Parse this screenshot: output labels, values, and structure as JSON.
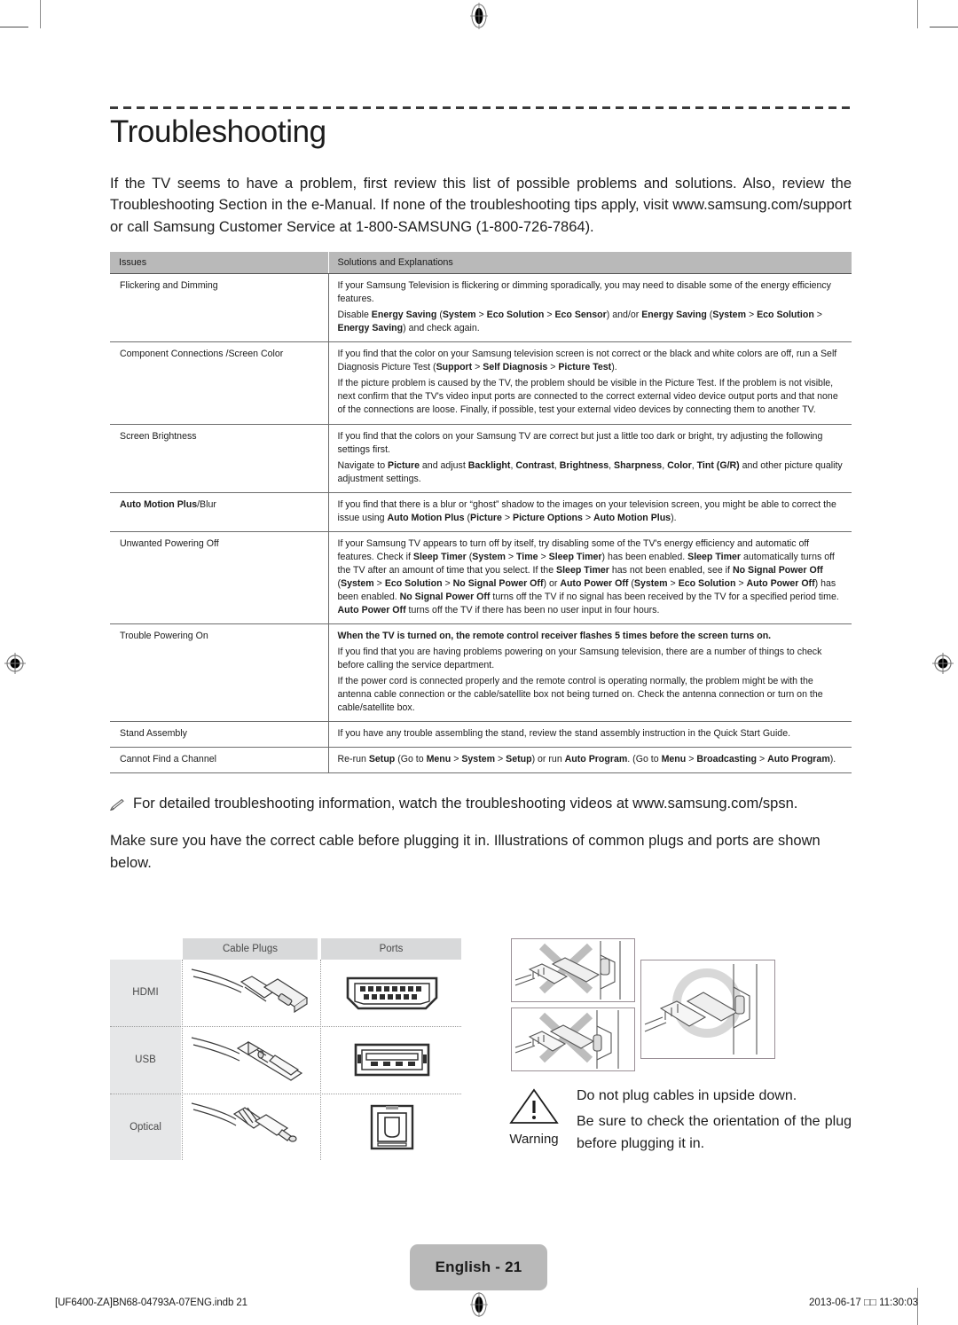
{
  "document": {
    "chapter_title": "Troubleshooting",
    "intro": "If the TV seems to have a problem, first review this list of possible problems and solutions. Also, review the Troubleshooting Section in the e-Manual. If none of the troubleshooting tips apply, visit www.samsung.com/support or call Samsung Customer Service at 1-800-SAMSUNG (1-800-726-7864)."
  },
  "troubleshooting_table": {
    "headers": [
      "Issues",
      "Solutions and Explanations"
    ],
    "rows": [
      {
        "issue": "Flickering and Dimming",
        "paragraphs": [
          [
            {
              "t": "If your Samsung Television is flickering or dimming sporadically, you may need to disable some of the energy efficiency features.",
              "b": false
            }
          ],
          [
            {
              "t": "Disable ",
              "b": false
            },
            {
              "t": "Energy Saving",
              "b": true
            },
            {
              "t": " (",
              "b": false
            },
            {
              "t": "System",
              "b": true
            },
            {
              "t": " > ",
              "b": false
            },
            {
              "t": "Eco Solution",
              "b": true
            },
            {
              "t": " > ",
              "b": false
            },
            {
              "t": "Eco Sensor",
              "b": true
            },
            {
              "t": ") and/or ",
              "b": false
            },
            {
              "t": "Energy Saving",
              "b": true
            },
            {
              "t": " (",
              "b": false
            },
            {
              "t": "System",
              "b": true
            },
            {
              "t": " > ",
              "b": false
            },
            {
              "t": "Eco Solution",
              "b": true
            },
            {
              "t": " > ",
              "b": false
            },
            {
              "t": "Energy Saving",
              "b": true
            },
            {
              "t": ") and check again.",
              "b": false
            }
          ]
        ]
      },
      {
        "issue": "Component Connections /Screen Color",
        "paragraphs": [
          [
            {
              "t": "If you find that the color on your Samsung television screen is not correct or the black and white colors are off, run a Self Diagnosis Picture Test (",
              "b": false
            },
            {
              "t": "Support",
              "b": true
            },
            {
              "t": " > ",
              "b": false
            },
            {
              "t": "Self Diagnosis",
              "b": true
            },
            {
              "t": " > ",
              "b": false
            },
            {
              "t": "Picture Test",
              "b": true
            },
            {
              "t": ").",
              "b": false
            }
          ],
          [
            {
              "t": "If the picture problem is caused by the TV, the problem should be visible in the Picture Test. If the problem is not visible, next confirm that the TV's video input ports are connected to the correct external video device output ports and that none of the connections are loose. Finally, if possible, test your external video devices by connecting them to another TV.",
              "b": false
            }
          ]
        ]
      },
      {
        "issue": "Screen Brightness",
        "paragraphs": [
          [
            {
              "t": "If you find that the colors on your Samsung TV are correct but just a little too dark or bright, try adjusting the following settings first.",
              "b": false
            }
          ],
          [
            {
              "t": "Navigate to ",
              "b": false
            },
            {
              "t": "Picture",
              "b": true
            },
            {
              "t": " and adjust ",
              "b": false
            },
            {
              "t": "Backlight",
              "b": true
            },
            {
              "t": ", ",
              "b": false
            },
            {
              "t": "Contrast",
              "b": true
            },
            {
              "t": ", ",
              "b": false
            },
            {
              "t": "Brightness",
              "b": true
            },
            {
              "t": ", ",
              "b": false
            },
            {
              "t": "Sharpness",
              "b": true
            },
            {
              "t": ", ",
              "b": false
            },
            {
              "t": "Color",
              "b": true
            },
            {
              "t": ", ",
              "b": false
            },
            {
              "t": "Tint (G/R)",
              "b": true
            },
            {
              "t": " and other picture quality adjustment settings.",
              "b": false
            }
          ]
        ]
      },
      {
        "issue_rich": [
          {
            "t": "Auto Motion Plus",
            "b": true
          },
          {
            "t": "/Blur",
            "b": false
          }
        ],
        "issue": "Auto Motion Plus/Blur",
        "paragraphs": [
          [
            {
              "t": "If you find that there is a blur or “ghost” shadow to the images on your television screen, you might be able to correct the issue using ",
              "b": false
            },
            {
              "t": "Auto Motion Plus",
              "b": true
            },
            {
              "t": " (",
              "b": false
            },
            {
              "t": "Picture",
              "b": true
            },
            {
              "t": " > ",
              "b": false
            },
            {
              "t": "Picture Options",
              "b": true
            },
            {
              "t": " > ",
              "b": false
            },
            {
              "t": "Auto Motion Plus",
              "b": true
            },
            {
              "t": ").",
              "b": false
            }
          ]
        ]
      },
      {
        "issue": "Unwanted Powering Off",
        "paragraphs": [
          [
            {
              "t": "If your Samsung TV appears to turn off by itself, try disabling some of the TV's energy efficiency and automatic off features. Check if ",
              "b": false
            },
            {
              "t": "Sleep Timer",
              "b": true
            },
            {
              "t": " (",
              "b": false
            },
            {
              "t": "System",
              "b": true
            },
            {
              "t": " > ",
              "b": false
            },
            {
              "t": "Time",
              "b": true
            },
            {
              "t": " > ",
              "b": false
            },
            {
              "t": "Sleep Timer",
              "b": true
            },
            {
              "t": ") has been enabled. ",
              "b": false
            },
            {
              "t": "Sleep Timer",
              "b": true
            },
            {
              "t": " automatically turns off the TV after an amount of time that you select. If the ",
              "b": false
            },
            {
              "t": "Sleep Timer",
              "b": true
            },
            {
              "t": " has not been enabled, see if ",
              "b": false
            },
            {
              "t": "No Signal Power Off",
              "b": true
            },
            {
              "t": " (",
              "b": false
            },
            {
              "t": "System",
              "b": true
            },
            {
              "t": " > ",
              "b": false
            },
            {
              "t": "Eco Solution",
              "b": true
            },
            {
              "t": " > ",
              "b": false
            },
            {
              "t": "No Signal Power Off",
              "b": true
            },
            {
              "t": ") or ",
              "b": false
            },
            {
              "t": "Auto Power Off",
              "b": true
            },
            {
              "t": " (",
              "b": false
            },
            {
              "t": "System",
              "b": true
            },
            {
              "t": " > ",
              "b": false
            },
            {
              "t": "Eco Solution",
              "b": true
            },
            {
              "t": " > ",
              "b": false
            },
            {
              "t": "Auto Power Off",
              "b": true
            },
            {
              "t": ") has been enabled. ",
              "b": false
            },
            {
              "t": "No Signal Power Off",
              "b": true
            },
            {
              "t": " turns off the TV if no signal has been received by the TV for a specified period time. ",
              "b": false
            },
            {
              "t": "Auto Power Off",
              "b": true
            },
            {
              "t": " turns off the TV if there has been no user input in four hours.",
              "b": false
            }
          ]
        ]
      },
      {
        "issue": "Trouble Powering On",
        "paragraphs": [
          [
            {
              "t": "When the TV is turned on, the remote control receiver flashes 5 times before the screen turns on.",
              "b": true
            }
          ],
          [
            {
              "t": "If you find that you are having problems powering on your Samsung television, there are a number of things to check before calling the service department.",
              "b": false
            }
          ],
          [
            {
              "t": "If the power cord is connected properly and the remote control is operating normally, the problem might be with the antenna cable connection or the cable/satellite box not being turned on. Check the antenna connection or turn on the cable/satellite box.",
              "b": false
            }
          ]
        ]
      },
      {
        "issue": "Stand Assembly",
        "paragraphs": [
          [
            {
              "t": "If you have any trouble assembling the stand, review the stand assembly instruction in the Quick Start Guide.",
              "b": false
            }
          ]
        ]
      },
      {
        "issue": "Cannot Find a Channel",
        "paragraphs": [
          [
            {
              "t": "Re-run ",
              "b": false
            },
            {
              "t": "Setup",
              "b": true
            },
            {
              "t": " (Go to ",
              "b": false
            },
            {
              "t": "Menu",
              "b": true
            },
            {
              "t": " > ",
              "b": false
            },
            {
              "t": "System",
              "b": true
            },
            {
              "t": " > ",
              "b": false
            },
            {
              "t": "Setup",
              "b": true
            },
            {
              "t": ") or run ",
              "b": false
            },
            {
              "t": "Auto Program",
              "b": true
            },
            {
              "t": ". (Go to ",
              "b": false
            },
            {
              "t": "Menu",
              "b": true
            },
            {
              "t": " > ",
              "b": false
            },
            {
              "t": "Broadcasting",
              "b": true
            },
            {
              "t": " > ",
              "b": false
            },
            {
              "t": "Auto Program",
              "b": true
            },
            {
              "t": ").",
              "b": false
            }
          ]
        ]
      }
    ]
  },
  "note": {
    "icon": "pencil-note-icon",
    "glyph": "✎",
    "text": "For detailed troubleshooting information, watch the troubleshooting videos at www.samsung.com/spsn."
  },
  "lead_paragraph": "Make sure you have the correct cable before plugging it in. Illustrations of common plugs and ports are shown below.",
  "cable_table": {
    "headers": [
      "Cable Plugs",
      "Ports"
    ],
    "rows": [
      {
        "label": "HDMI",
        "plug_icon": "hdmi-plug-illustration",
        "port_icon": "hdmi-port-illustration"
      },
      {
        "label": "USB",
        "plug_icon": "usb-plug-illustration",
        "port_icon": "usb-port-illustration"
      },
      {
        "label": "Optical",
        "plug_icon": "optical-plug-illustration",
        "port_icon": "optical-port-illustration"
      }
    ]
  },
  "warning": {
    "label": "Warning",
    "icon": "warning-triangle-icon",
    "lines": [
      "Do not plug cables in upside down.",
      "Be sure to check the orientation of the plug before plugging it in."
    ]
  },
  "footer": {
    "page_badge": "English - 21",
    "file_ref": "[UF6400-ZA]BN68-04793A-07ENG.indb   21",
    "date": "2013-06-17",
    "cjk_placeholder": "□□",
    "time": "11:30:03"
  },
  "colors": {
    "table_header_gray": "#b9b9b9",
    "cable_header_gray": "#d8d9da",
    "cable_label_gray": "#e6e7e8",
    "badge_gray": "#b9b9b9",
    "rule_gray": "#6d6d6d",
    "text": "#1d1d1d"
  }
}
